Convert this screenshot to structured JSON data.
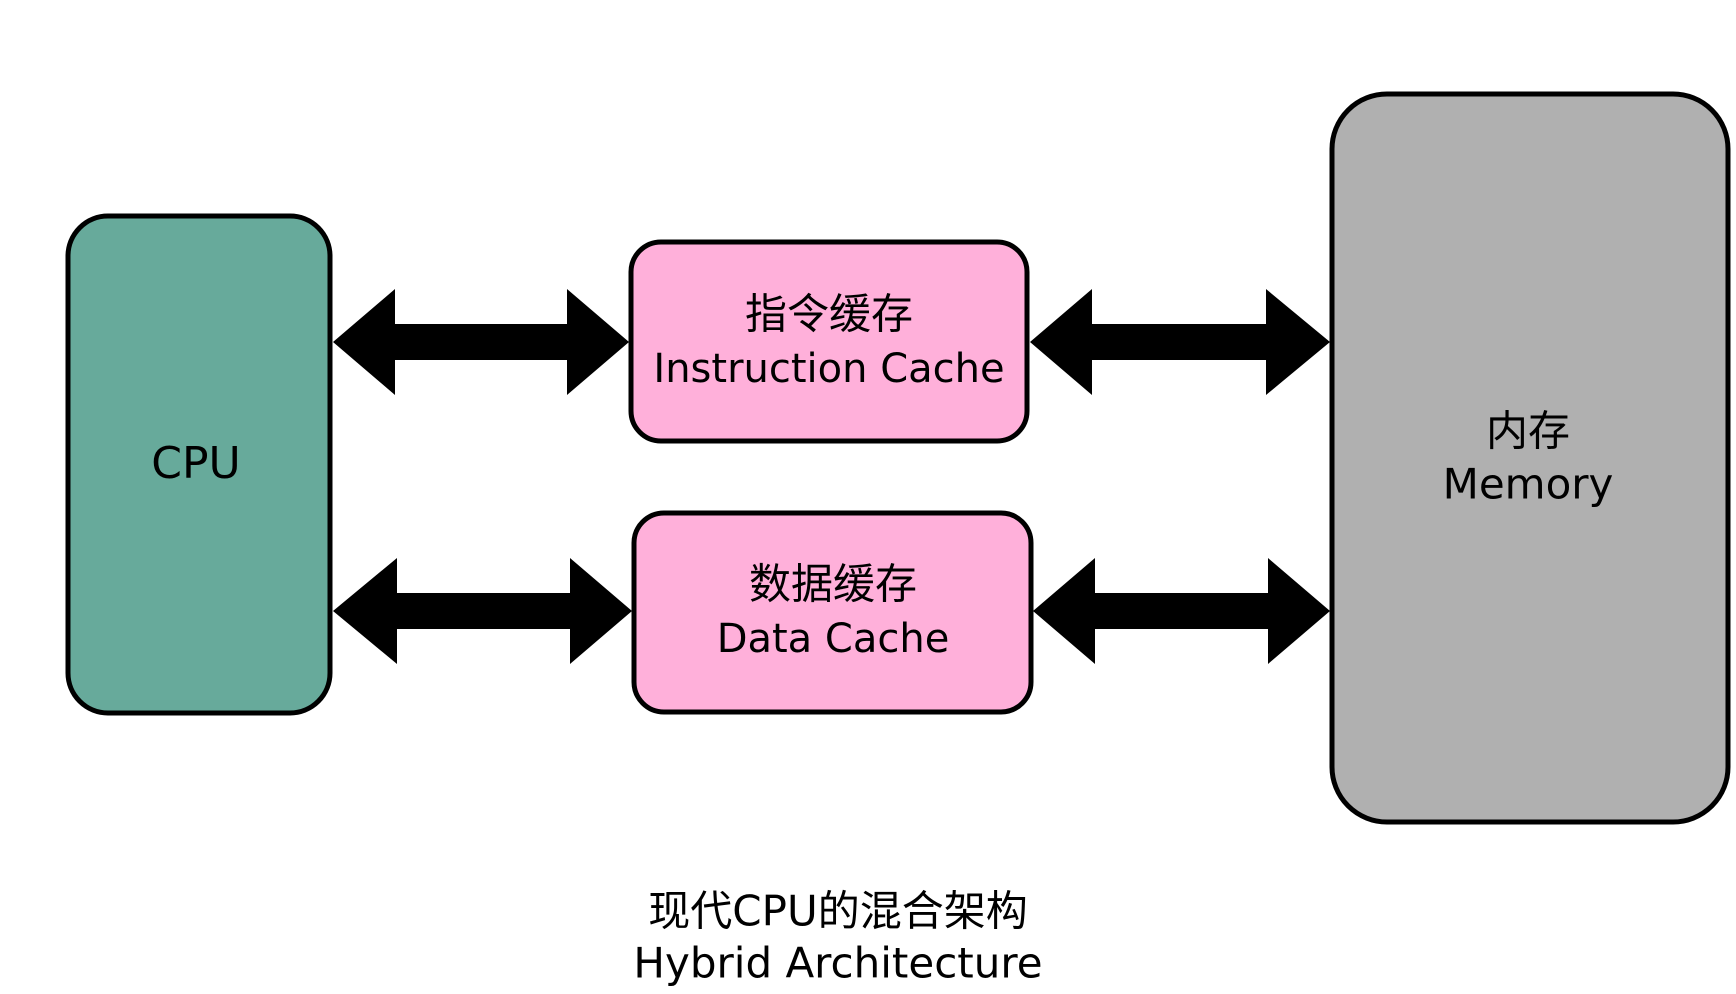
{
  "diagram": {
    "cpu": {
      "label": "CPU",
      "color": "#67aa9b"
    },
    "instruction_cache": {
      "label_zh": "指令缓存",
      "label_en": "Instruction Cache",
      "color": "#ffb0da"
    },
    "data_cache": {
      "label_zh": "数据缓存",
      "label_en": "Data Cache",
      "color": "#ffb0da"
    },
    "memory": {
      "label_zh": "内存",
      "label_en": "Memory",
      "color": "#b0b0b0"
    },
    "connections": [
      {
        "from": "cpu",
        "to": "instruction_cache",
        "direction": "bidirectional"
      },
      {
        "from": "instruction_cache",
        "to": "memory",
        "direction": "bidirectional"
      },
      {
        "from": "cpu",
        "to": "data_cache",
        "direction": "bidirectional"
      },
      {
        "from": "data_cache",
        "to": "memory",
        "direction": "bidirectional"
      }
    ]
  },
  "caption": {
    "line1": "现代CPU的混合架构",
    "line2": "Hybrid Architecture"
  }
}
